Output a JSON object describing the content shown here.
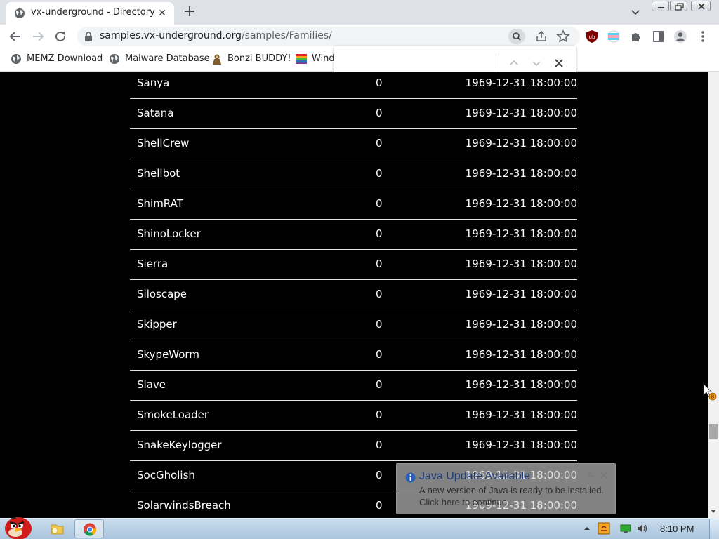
{
  "browser": {
    "tab_title": "vx-underground - Directory",
    "url_host": "samples.vx-underground.org",
    "url_path": "/samples/Families/",
    "find_query": ""
  },
  "bookmarks": [
    {
      "label": "MEMZ Download",
      "icon": "globe-icon"
    },
    {
      "label": "Malware Database",
      "icon": "globe-icon"
    },
    {
      "label": "Bonzi BUDDY!",
      "icon": "bonzi-icon"
    },
    {
      "label": "Wind",
      "icon": "windows-flag-icon"
    }
  ],
  "directory": {
    "rows": [
      {
        "name": "Sanya",
        "count": "0",
        "date": "1969-12-31 18:00:00"
      },
      {
        "name": "Satana",
        "count": "0",
        "date": "1969-12-31 18:00:00"
      },
      {
        "name": "ShellCrew",
        "count": "0",
        "date": "1969-12-31 18:00:00"
      },
      {
        "name": "Shellbot",
        "count": "0",
        "date": "1969-12-31 18:00:00"
      },
      {
        "name": "ShimRAT",
        "count": "0",
        "date": "1969-12-31 18:00:00"
      },
      {
        "name": "ShinoLocker",
        "count": "0",
        "date": "1969-12-31 18:00:00"
      },
      {
        "name": "Sierra",
        "count": "0",
        "date": "1969-12-31 18:00:00"
      },
      {
        "name": "Siloscape",
        "count": "0",
        "date": "1969-12-31 18:00:00"
      },
      {
        "name": "Skipper",
        "count": "0",
        "date": "1969-12-31 18:00:00"
      },
      {
        "name": "SkypeWorm",
        "count": "0",
        "date": "1969-12-31 18:00:00"
      },
      {
        "name": "Slave",
        "count": "0",
        "date": "1969-12-31 18:00:00"
      },
      {
        "name": "SmokeLoader",
        "count": "0",
        "date": "1969-12-31 18:00:00"
      },
      {
        "name": "SnakeKeylogger",
        "count": "0",
        "date": "1969-12-31 18:00:00"
      },
      {
        "name": "SocGholish",
        "count": "0",
        "date": "1969-12-31 18:00:00"
      },
      {
        "name": "SolarwindsBreach",
        "count": "0",
        "date": "1969-12-31 18:00:00"
      }
    ]
  },
  "java_balloon": {
    "title": "Java Update Available",
    "line1": "A new version of Java is ready to be installed.",
    "line2": "Click here to continue..."
  },
  "taskbar": {
    "clock": "8:10 PM"
  },
  "colors": {
    "page_background": "#000000",
    "row_text": "#ffffff",
    "row_divider": "#e6e6e6",
    "chrome_tab_strip": "#dee1e6"
  }
}
